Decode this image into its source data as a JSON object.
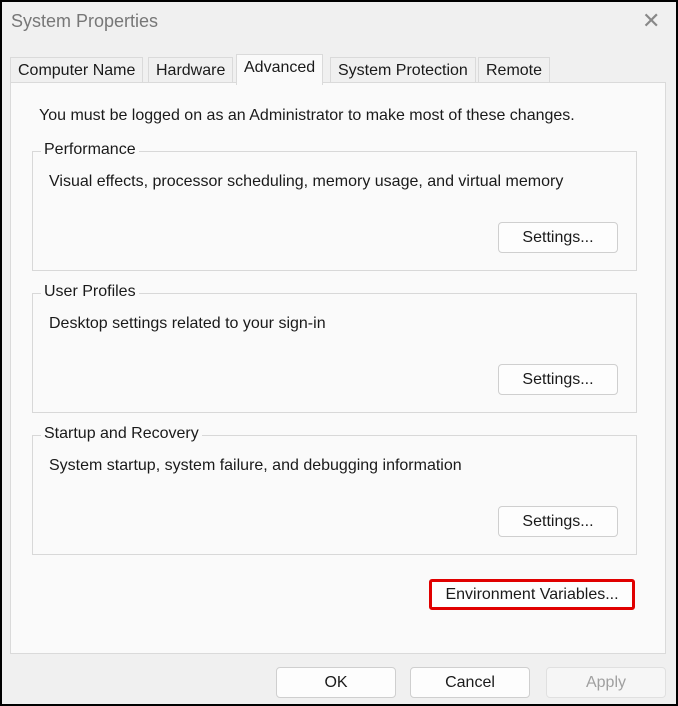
{
  "window": {
    "title": "System Properties"
  },
  "tabs": [
    "Computer Name",
    "Hardware",
    "Advanced",
    "System Protection",
    "Remote"
  ],
  "panel": {
    "note": "You must be logged on as an Administrator to make most of these changes.",
    "groups": [
      {
        "label": "Performance",
        "description": "Visual effects, processor scheduling, memory usage, and virtual memory",
        "button": "Settings..."
      },
      {
        "label": "User Profiles",
        "description": "Desktop settings related to your sign-in",
        "button": "Settings..."
      },
      {
        "label": "Startup and Recovery",
        "description": "System startup, system failure, and debugging information",
        "button": "Settings..."
      }
    ],
    "env_button": "Environment Variables..."
  },
  "footer": {
    "ok": "OK",
    "cancel": "Cancel",
    "apply": "Apply"
  },
  "colors": {
    "highlight": "#e00000"
  }
}
